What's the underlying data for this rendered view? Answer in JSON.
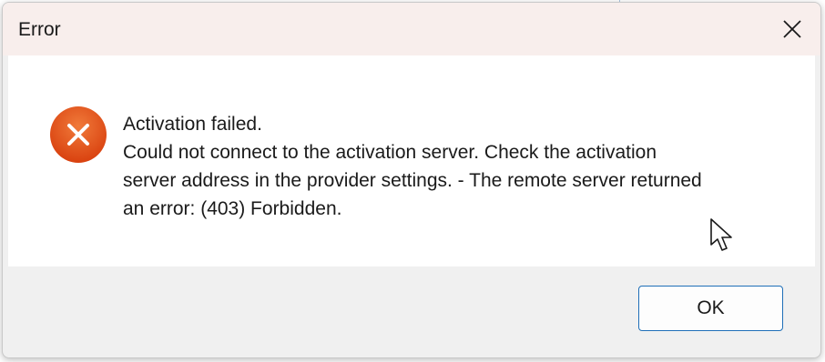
{
  "dialog": {
    "title": "Error",
    "close_icon": "close-icon",
    "icon": "error-icon",
    "message_lines": [
      "Activation failed.",
      "Could not connect to the activation server. Check the activation",
      "server address in the provider settings. - The remote server returned",
      "an error: (403) Forbidden."
    ],
    "ok_label": "OK"
  },
  "colors": {
    "error_icon": "#e8531e",
    "ok_border": "#1f6fb8",
    "titlebar_bg": "#f8eeec",
    "footer_bg": "#f0f0f0"
  }
}
